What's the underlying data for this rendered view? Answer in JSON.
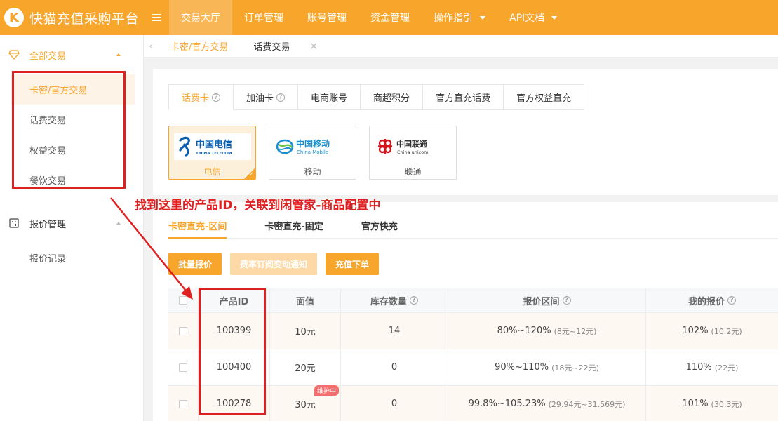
{
  "app": {
    "logo_letter": "K",
    "title": "快猫充值采购平台"
  },
  "nav": [
    {
      "label": "交易大厅",
      "active": true,
      "dropdown": false
    },
    {
      "label": "订单管理",
      "active": false,
      "dropdown": false
    },
    {
      "label": "账号管理",
      "active": false,
      "dropdown": false
    },
    {
      "label": "资金管理",
      "active": false,
      "dropdown": false
    },
    {
      "label": "操作指引",
      "active": false,
      "dropdown": true
    },
    {
      "label": "API文档",
      "active": false,
      "dropdown": true
    }
  ],
  "sidebar": {
    "group1": {
      "label": "全部交易",
      "icon": "diamond-icon"
    },
    "group1_items": [
      "卡密/官方交易",
      "话费交易",
      "权益交易",
      "餐饮交易"
    ],
    "group2": {
      "label": "报价管理",
      "icon": "calculator-icon"
    },
    "group2_items": [
      "报价记录"
    ]
  },
  "page_tabs": [
    "卡密/官方交易",
    "话费交易"
  ],
  "category_tabs": [
    "话费卡",
    "加油卡",
    "电商账号",
    "商超积分",
    "官方直充话费",
    "官方权益直充"
  ],
  "carriers": [
    {
      "label": "电信",
      "logo_cn": "中国电信",
      "logo_en": "CHINA TELECOM",
      "color": "#0b5fb0",
      "selected": true
    },
    {
      "label": "移动",
      "logo_cn": "中国移动",
      "logo_en": "China Mobile",
      "color": "#1a8fd0",
      "selected": false
    },
    {
      "label": "联通",
      "logo_cn": "中国联通",
      "logo_en": "China unicom",
      "color": "#d6141b",
      "selected": false
    }
  ],
  "sub_tabs": [
    "卡密直充-区间",
    "卡密直充-固定",
    "官方快充"
  ],
  "buttons": {
    "batch_quote": "批量报价",
    "subscribe": "费率订阅变动通知",
    "recharge": "充值下单"
  },
  "table": {
    "headers": [
      "产品ID",
      "面值",
      "库存数量",
      "报价区间",
      "我的报价"
    ],
    "rows": [
      {
        "id": "100399",
        "face": "10元",
        "stock": "14",
        "range": "80%~120%",
        "range_amt": "(8元~12元)",
        "my": "102%",
        "my_amt": "(10.2元)",
        "badge": ""
      },
      {
        "id": "100400",
        "face": "20元",
        "stock": "0",
        "range": "90%~110%",
        "range_amt": "(18元~22元)",
        "my": "110%",
        "my_amt": "(22元)",
        "badge": ""
      },
      {
        "id": "100278",
        "face": "30元",
        "stock": "0",
        "range": "99.8%~105.23%",
        "range_amt": "(29.94元~31.569元)",
        "my": "101%",
        "my_amt": "(30.3元)",
        "badge": "维护中"
      }
    ]
  },
  "annotation": {
    "text": "找到这里的产品ID，关联到闲管家-商品配置中",
    "color": "#e02020"
  },
  "colors": {
    "accent": "#f7a52b",
    "annotation_red": "#e02020"
  }
}
